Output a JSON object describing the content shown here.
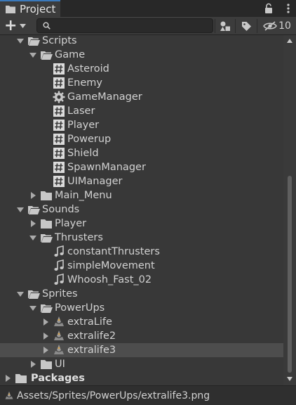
{
  "tab": {
    "title": "Project"
  },
  "toolbar": {
    "create_label": "+",
    "search": {
      "value": "",
      "placeholder": ""
    },
    "hidden_count": "10"
  },
  "tree": {
    "scripts": "Scripts",
    "game": "Game",
    "asteroid": "Asteroid",
    "enemy": "Enemy",
    "game_manager": "GameManager",
    "laser": "Laser",
    "player": "Player",
    "powerup": "Powerup",
    "shield": "Shield",
    "spawn_manager": "SpawnManager",
    "ui_manager": "UIManager",
    "main_menu": "Main_Menu",
    "sounds": "Sounds",
    "sounds_player": "Player",
    "thrusters": "Thrusters",
    "constant_thrusters": "constantThrusters",
    "simple_movement": "simpleMovement",
    "whoosh": "Whoosh_Fast_02",
    "sprites": "Sprites",
    "powerups": "PowerUps",
    "extra_life": "extraLife",
    "extralife2": "extralife2",
    "extralife3": "extralife3",
    "ui": "UI",
    "packages": "Packages"
  },
  "status": {
    "path": "Assets/Sprites/PowerUps/extralife3.png"
  },
  "colors": {
    "accent": "#3a79bb",
    "background": "#383838",
    "selected_row": "#4d4d4d"
  }
}
